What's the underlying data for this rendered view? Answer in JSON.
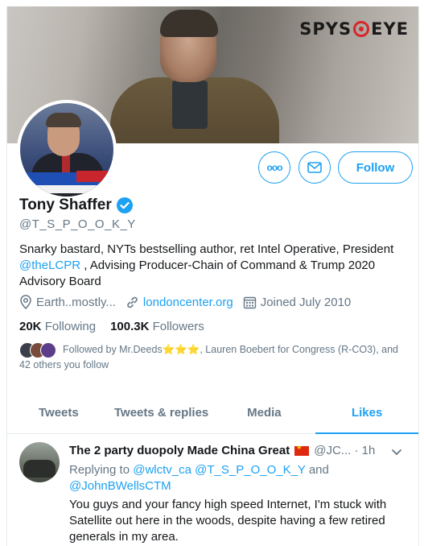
{
  "banner": {
    "logo_text_left": "SPYS",
    "logo_text_right": "EYE"
  },
  "actions": {
    "more_label": "ooo",
    "follow_label": "Follow"
  },
  "profile": {
    "name": "Tony Shaffer",
    "handle": "@T_S_P_O_O_K_Y",
    "bio_prefix": "Snarky bastard, NYTs bestselling author, ret Intel Operative, President",
    "bio_mention": "@theLCPR",
    "bio_suffix": ", Advising Producer-Chain of Command & Trump 2020 Advisory Board",
    "location": "Earth..mostly...",
    "website": "londoncenter.org",
    "joined": "Joined July 2010",
    "following_count": "20K",
    "following_label": "Following",
    "followers_count": "100.3K",
    "followers_label": "Followers",
    "followed_by_line1": "Followed by Mr.Deeds⭐⭐⭐, Lauren Boebert for Congress (R-CO3), and",
    "followed_by_line2": "42 others you follow"
  },
  "tabs": [
    {
      "label": "Tweets"
    },
    {
      "label": "Tweets & replies"
    },
    {
      "label": "Media"
    },
    {
      "label": "Likes"
    }
  ],
  "tweet": {
    "author_name": "The 2 party duopoly Made China Great",
    "author_meta": "@JC... · 1h",
    "reply_prefix": "Replying to",
    "reply_mention1": "@wlctv_ca",
    "reply_mention2": "@T_S_P_O_O_K_Y",
    "reply_and": "and",
    "reply_mention3": "@JohnBWellsCTM",
    "text": "You guys and your fancy high speed Internet, I'm stuck with Satellite out here in the woods, despite having a few retired generals in my area."
  },
  "colors": {
    "accent": "#1da1f2",
    "muted": "#657786",
    "text": "#14171a"
  }
}
